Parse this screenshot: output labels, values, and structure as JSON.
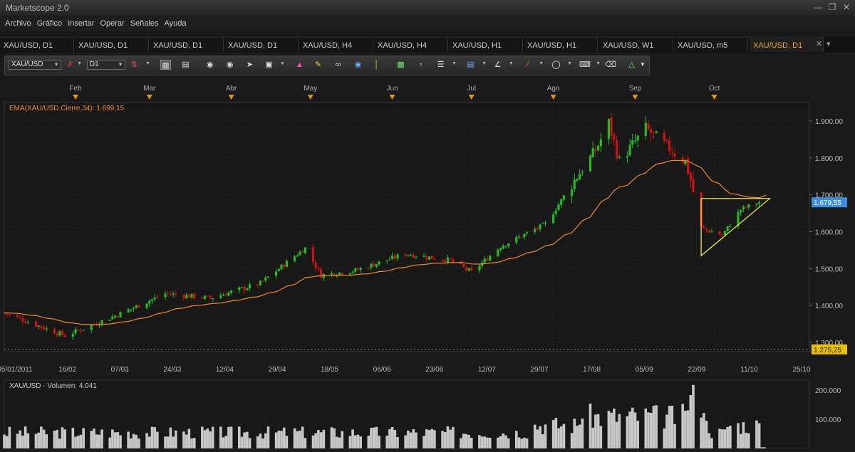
{
  "app": {
    "title": "Marketscope 2.0"
  },
  "menu": [
    "Archivo",
    "Gráfico",
    "Insertar",
    "Operar",
    "Señales",
    "Ayuda"
  ],
  "tabs": [
    {
      "label": "XAU/USD, D1",
      "active": false
    },
    {
      "label": "XAU/USD, D1",
      "active": false
    },
    {
      "label": "XAU/USD, D1",
      "active": false
    },
    {
      "label": "XAU/USD, D1",
      "active": false
    },
    {
      "label": "XAU/USD, H4",
      "active": false
    },
    {
      "label": "XAU/USD, H4",
      "active": false
    },
    {
      "label": "XAU/USD, H1",
      "active": false
    },
    {
      "label": "XAU/USD, H1",
      "active": false
    },
    {
      "label": "XAU/USD, W1",
      "active": false
    },
    {
      "label": "XAU/USD, m5",
      "active": false
    },
    {
      "label": "XAU/USD, D1",
      "active": true
    }
  ],
  "toolbar": {
    "instrument": "XAU/USD",
    "timeframe": "D1"
  },
  "chart": {
    "indicator_label": "EMA(XAU/USD.Cierre,34): 1.699,15",
    "price_axis": [
      "1.900,00",
      "1.800,00",
      "1.700,00",
      "1.600,00",
      "1.500,00",
      "1.400,00",
      "1.300,00"
    ],
    "current_price": "1.679,55",
    "low_price": "1.275,25",
    "months": [
      "Feb",
      "Mar",
      "Abr",
      "May",
      "Jun",
      "Jul",
      "Ago",
      "Sep",
      "Oct"
    ],
    "dates": [
      "05/01/2011",
      "16/02",
      "07/03",
      "24/03",
      "12/04",
      "29/04",
      "18/05",
      "06/06",
      "23/06",
      "12/07",
      "29/07",
      "17/08",
      "05/09",
      "22/09",
      "11/10",
      "25/10"
    ],
    "volume_label": "XAU/USD - Volumen: 4.041",
    "volume_axis": [
      "200.000",
      "100.000"
    ]
  },
  "colors": {
    "up": "#22bb22",
    "down": "#cc1111",
    "ema": "#ee8833",
    "triangle": "#e8e84a",
    "price_badge": "#3a8de0",
    "low_badge": "#e8c000",
    "accent": "#e8a63a"
  },
  "chart_data": {
    "type": "candlestick",
    "symbol": "XAU/USD",
    "timeframe": "D1",
    "ylim": [
      1275,
      1950
    ],
    "ohlc_anchors": [
      [
        "2011-01-05",
        1380
      ],
      [
        "2011-01-28",
        1318
      ],
      [
        "2011-02-16",
        1372
      ],
      [
        "2011-03-07",
        1432
      ],
      [
        "2011-03-24",
        1420
      ],
      [
        "2011-04-12",
        1460
      ],
      [
        "2011-04-29",
        1556
      ],
      [
        "2011-05-05",
        1482
      ],
      [
        "2011-05-18",
        1495
      ],
      [
        "2011-06-06",
        1540
      ],
      [
        "2011-06-23",
        1522
      ],
      [
        "2011-07-01",
        1490
      ],
      [
        "2011-07-12",
        1560
      ],
      [
        "2011-07-29",
        1620
      ],
      [
        "2011-08-10",
        1750
      ],
      [
        "2011-08-17",
        1820
      ],
      [
        "2011-08-22",
        1895
      ],
      [
        "2011-08-26",
        1790
      ],
      [
        "2011-09-05",
        1880
      ],
      [
        "2011-09-13",
        1830
      ],
      [
        "2011-09-20",
        1790
      ],
      [
        "2011-09-22",
        1740
      ],
      [
        "2011-09-26",
        1610
      ],
      [
        "2011-10-04",
        1590
      ],
      [
        "2011-10-11",
        1660
      ],
      [
        "2011-10-18",
        1680
      ]
    ],
    "ema": {
      "name": "EMA(XAU/USD.Cierre,34)",
      "last": 1699.15
    },
    "last_price": 1679.55,
    "marked_low": 1275.25,
    "volume_last": 4041,
    "volume_ylim": [
      0,
      220000
    ]
  }
}
